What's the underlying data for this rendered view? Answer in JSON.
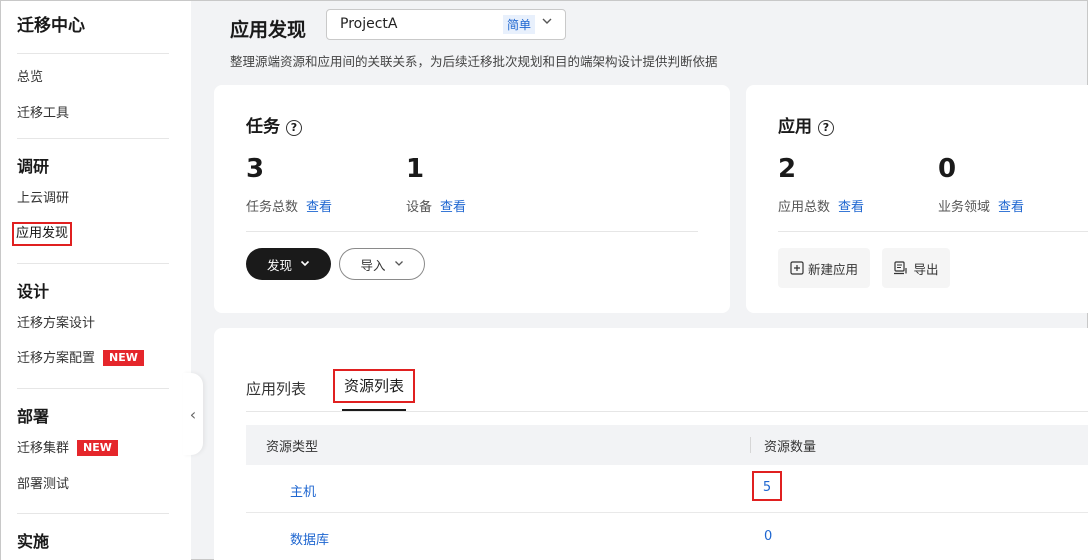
{
  "sidebar": {
    "title": "迁移中心",
    "overview": "总览",
    "migration_tools": "迁移工具",
    "section_research": "调研",
    "cloud_research": "上云调研",
    "app_discovery": "应用发现",
    "section_design": "设计",
    "plan_design": "迁移方案设计",
    "plan_config": "迁移方案配置",
    "section_deploy": "部署",
    "migration_cluster": "迁移集群",
    "deploy_test": "部署测试",
    "section_implement": "实施",
    "new_badge": "NEW"
  },
  "header": {
    "title": "应用发现",
    "project_name": "ProjectA",
    "project_mode": "简单",
    "description": "整理源端资源和应用间的关联关系，为后续迁移批次规划和目的端架构设计提供判断依据"
  },
  "task_card": {
    "title": "任务",
    "task_total": "3",
    "task_total_label": "任务总数",
    "device_total": "1",
    "device_label": "设备",
    "view_link": "查看",
    "discover_button": "发现",
    "import_button": "导入"
  },
  "app_card": {
    "title": "应用",
    "app_total": "2",
    "app_total_label": "应用总数",
    "domain_total": "0",
    "domain_label": "业务领域",
    "view_link": "查看",
    "new_app_button": "新建应用",
    "export_button": "导出"
  },
  "tabs": {
    "app_list": "应用列表",
    "resource_list": "资源列表"
  },
  "table": {
    "col_type": "资源类型",
    "col_count": "资源数量",
    "rows": [
      {
        "type": "主机",
        "count": "5"
      },
      {
        "type": "数据库",
        "count": "0"
      }
    ]
  },
  "colors": {
    "link": "#1e66d0",
    "highlight_border": "#e02020",
    "badge": "#e5262b"
  }
}
